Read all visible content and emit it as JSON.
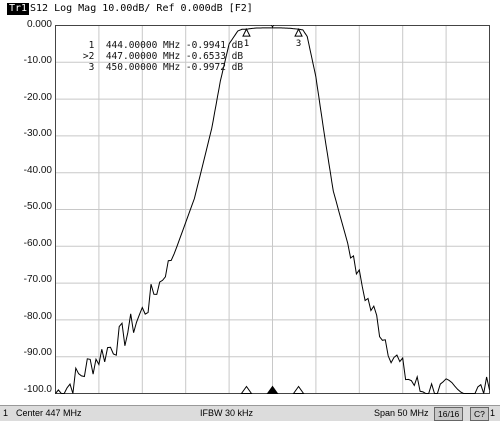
{
  "header": {
    "trace_label": "Tr1",
    "title": "S12 Log Mag 10.00dB/ Ref 0.000dB [F2]"
  },
  "markers": [
    {
      "id": "1",
      "prefix": " ",
      "freq": "444.00000 MHz",
      "value": "-0.9941 dB",
      "freq_mhz": 444.0,
      "value_db": -0.9941
    },
    {
      "id": "2",
      "prefix": ">",
      "freq": "447.00000 MHz",
      "value": "-0.6533 dB",
      "freq_mhz": 447.0,
      "value_db": -0.6533
    },
    {
      "id": "3",
      "prefix": " ",
      "freq": "450.00000 MHz",
      "value": "-0.9972 dB",
      "freq_mhz": 450.0,
      "value_db": -0.9972
    }
  ],
  "status": {
    "channel": "1",
    "center": "Center 447 MHz",
    "ifbw": "IFBW 30 kHz",
    "span": "Span 50 MHz",
    "points": "16/16",
    "extra": "C?",
    "trailing": "1"
  },
  "chart_data": {
    "type": "line",
    "xlim": [
      422,
      472
    ],
    "ylim": [
      -100,
      0
    ],
    "yticks": [
      "0.000",
      "-10.00",
      "-20.00",
      "-30.00",
      "-40.00",
      "-50.00",
      "-60.00",
      "-70.00",
      "-80.00",
      "-90.00",
      "-100.0"
    ],
    "grid": true,
    "trace_color": "#000000",
    "series": [
      {
        "x": [
          422.0,
          424.0,
          426.0,
          428.0,
          430.0,
          432.0,
          434.0,
          436.0,
          438.0,
          440.0,
          441.0,
          442.0,
          443.0,
          443.5,
          444.0,
          445.0,
          446.0,
          447.0,
          448.0,
          449.0,
          450.0,
          450.5,
          451.0,
          452.0,
          453.0,
          454.0,
          456.0,
          458.0,
          460.0,
          462.0,
          464.0,
          466.0,
          468.0,
          470.0,
          472.0
        ],
        "y": [
          -100.0,
          -97.0,
          -92.0,
          -88.0,
          -84.0,
          -78.0,
          -70.0,
          -60.0,
          -47.0,
          -28.0,
          -15.0,
          -5.0,
          -1.5,
          -1.0,
          -0.99,
          -0.7,
          -0.65,
          -0.65,
          -0.66,
          -0.75,
          -1.0,
          -1.2,
          -3.0,
          -14.0,
          -30.0,
          -45.0,
          -62.0,
          -75.0,
          -85.0,
          -94.0,
          -99.0,
          -99.5,
          -100.0,
          -100.0,
          -99.0
        ]
      }
    ]
  }
}
